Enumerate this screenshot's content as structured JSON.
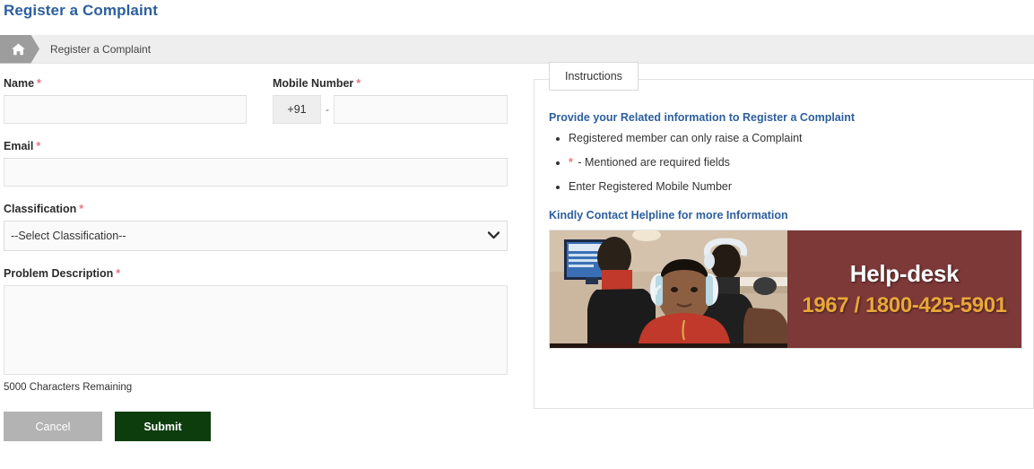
{
  "page": {
    "title": "Register a Complaint"
  },
  "breadcrumb": {
    "home_icon": "home-icon",
    "label": "Register a Complaint"
  },
  "form": {
    "name": {
      "label": "Name",
      "required_marker": "*",
      "value": "",
      "placeholder": ""
    },
    "mobile": {
      "label": "Mobile Number",
      "required_marker": "*",
      "country_code": "+91",
      "separator": "-",
      "value": "",
      "placeholder": ""
    },
    "email": {
      "label": "Email",
      "required_marker": "*",
      "value": "",
      "placeholder": ""
    },
    "classification": {
      "label": "Classification",
      "required_marker": "*",
      "selected": "--Select Classification--",
      "dropdown_icon": "chevron-down-icon"
    },
    "problem_description": {
      "label": "Problem Description",
      "required_marker": "*",
      "value": "",
      "placeholder": "",
      "counter": "5000 Characters Remaining"
    },
    "buttons": {
      "cancel": "Cancel",
      "submit": "Submit"
    }
  },
  "instructions_panel": {
    "tab_label": "Instructions",
    "lead": "Provide your Related information to Register a Complaint",
    "bullets": [
      "Registered member can only raise a Complaint",
      "- Mentioned are required fields",
      "Enter Registered Mobile Number"
    ],
    "bullet_marker": "*",
    "helpline_heading": "Kindly Contact Helpline for more Information",
    "banner": {
      "title": "Help-desk",
      "numbers": "1967 / 1800-425-5901",
      "photo_alt": "call-center-photo"
    }
  },
  "colors": {
    "title_blue": "#2c5f9e",
    "required_red": "#e8737f",
    "submit_green": "#0d3d0d",
    "cancel_gray": "#b3b3b3",
    "banner_maroon": "#7d3838",
    "banner_gold": "#e8a838",
    "breadcrumb_bg": "#eeeeee"
  }
}
